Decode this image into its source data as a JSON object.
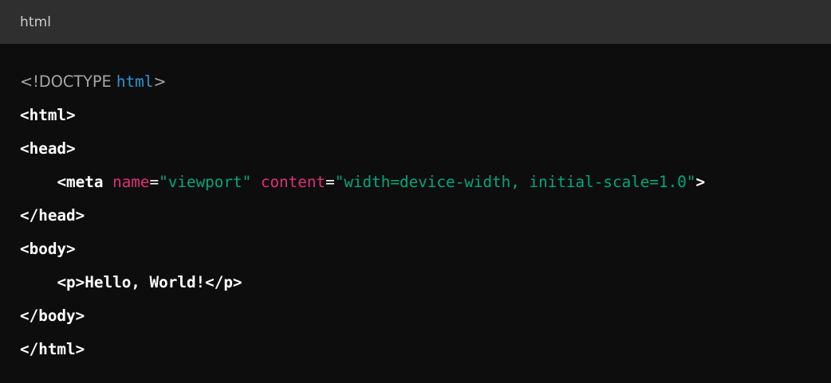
{
  "header": {
    "language": "html"
  },
  "code": {
    "line1": {
      "doctype_open": "<!DOCTYPE ",
      "doctype_kw": "html",
      "doctype_close": ">"
    },
    "line2": {
      "tag": "<html>"
    },
    "line3": {
      "tag": "<head>"
    },
    "line4": {
      "indent": "    ",
      "tag_open": "<meta ",
      "attr1": "name",
      "eq1": "=",
      "val1": "\"viewport\"",
      "space": " ",
      "attr2": "content",
      "eq2": "=",
      "val2": "\"width=device-width, initial-scale=1.0\"",
      "tag_close": ">"
    },
    "line5": {
      "tag": "</head>"
    },
    "line6": {
      "tag": "<body>"
    },
    "line7": {
      "indent": "    ",
      "text": "<p>Hello, World!</p>"
    },
    "line8": {
      "tag": "</body>"
    },
    "line9": {
      "tag": "</html>"
    }
  },
  "colors": {
    "background": "#0d0d0d",
    "header_background": "#2f2f2f",
    "tag": "#ffffff",
    "attribute": "#df3079",
    "string": "#00a67d",
    "doctype_keyword": "#2e95d3",
    "doctype": "#a6a6a6"
  }
}
